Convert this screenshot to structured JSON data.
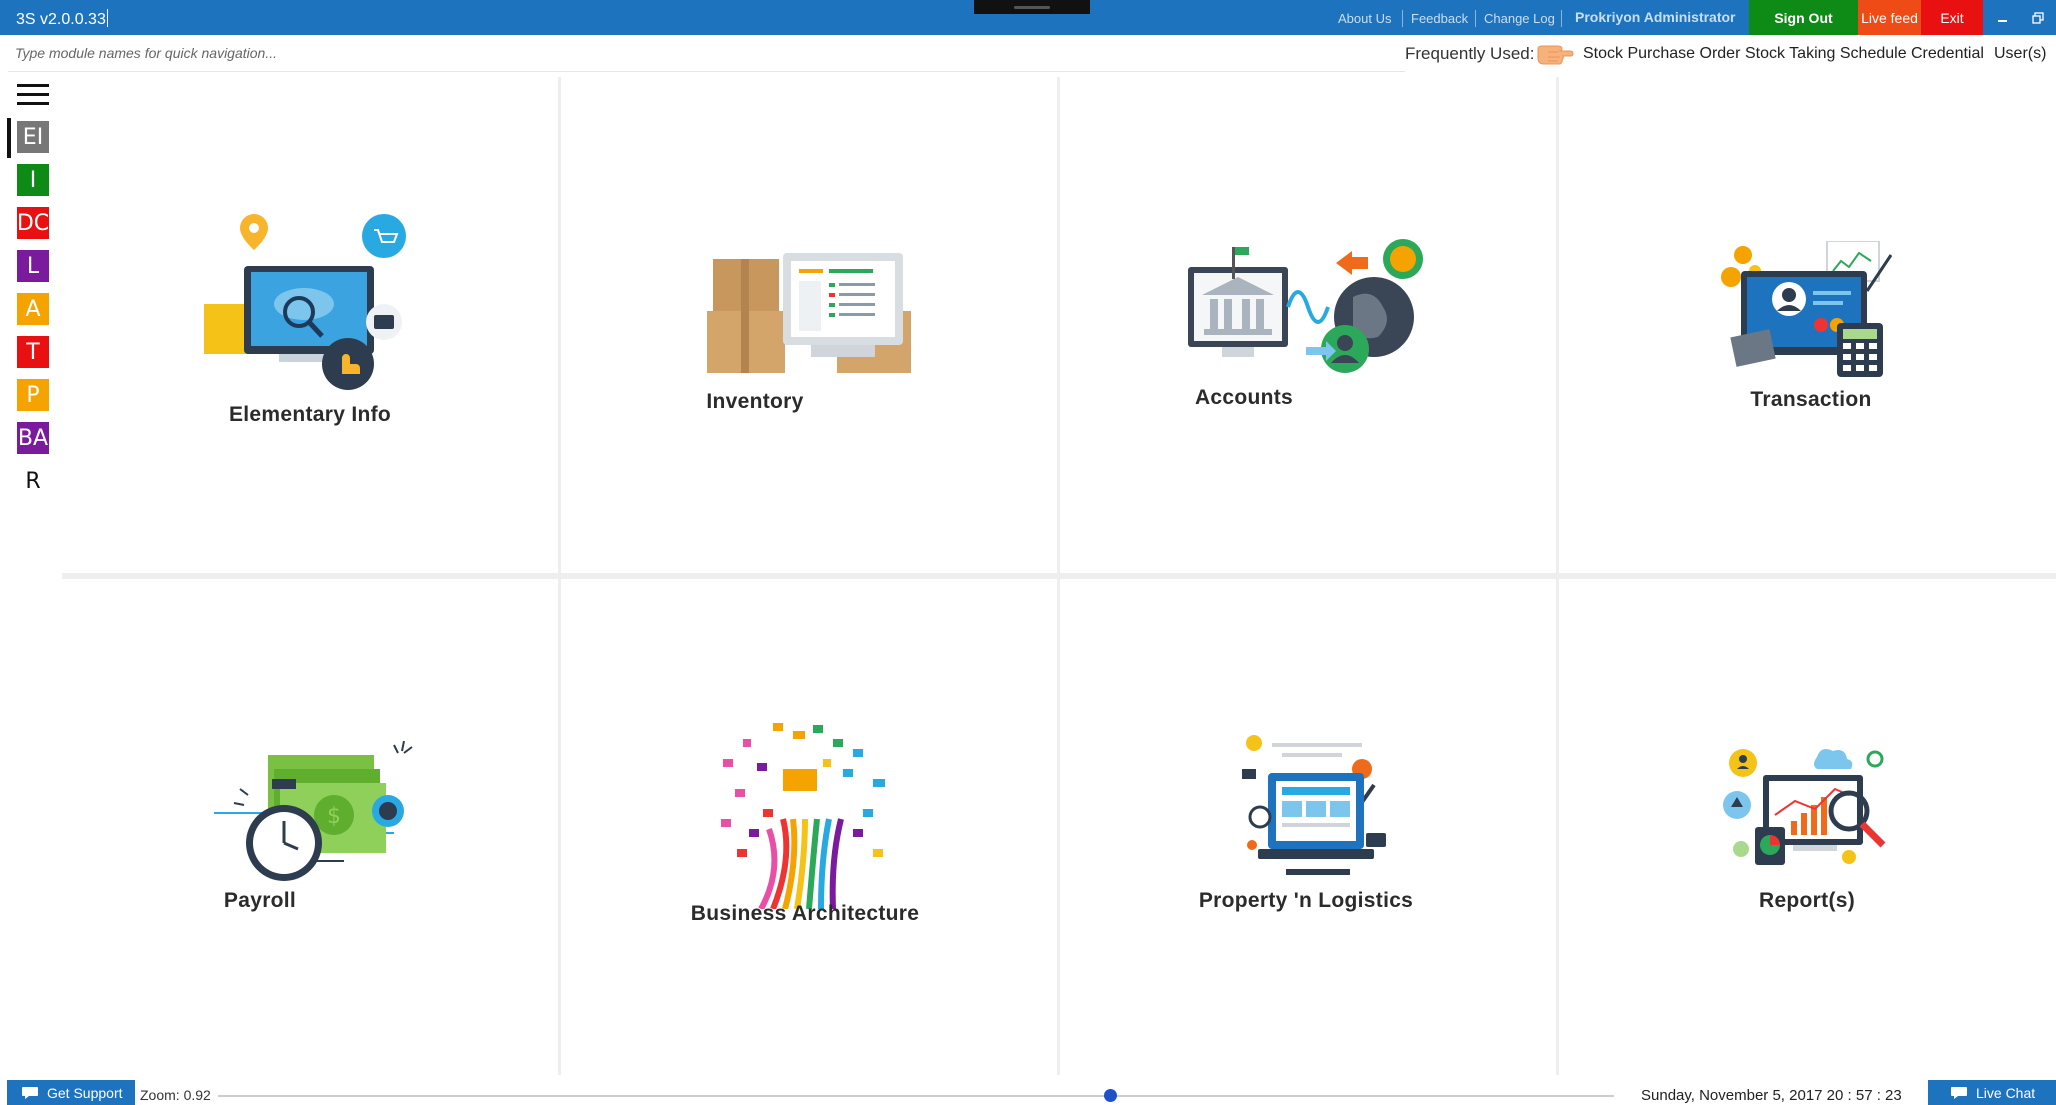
{
  "app": {
    "version": "3S v2.0.0.33"
  },
  "topbar": {
    "links": [
      "About Us",
      "Feedback",
      "Change Log"
    ],
    "user": "Prokriyon Administrator",
    "sign_out": "Sign Out",
    "live_feed": "Live feed",
    "exit": "Exit",
    "colors": {
      "bar": "#1e73be",
      "sign_out": "#0e8a16",
      "live_feed": "#ef4b17",
      "exit": "#e81010"
    }
  },
  "quick_nav": {
    "placeholder": "Type module names for quick navigation..."
  },
  "frequently_used": {
    "label": "Frequently Used:",
    "icon": "pointing-hand-icon",
    "items": [
      "Stock Purchase Order",
      "Stock Taking Schedule",
      "Credential",
      "User(s)"
    ]
  },
  "sidebar": {
    "items": [
      {
        "label": "EI",
        "color": "#777777"
      },
      {
        "label": "I",
        "color": "#0e8a16"
      },
      {
        "label": "DC",
        "color": "#e81010"
      },
      {
        "label": "L",
        "color": "#7a1a9c"
      },
      {
        "label": "A",
        "color": "#f5a300"
      },
      {
        "label": "T",
        "color": "#e81010"
      },
      {
        "label": "P",
        "color": "#f5a300"
      },
      {
        "label": "BA",
        "color": "#7a1a9c"
      },
      {
        "label": "R",
        "color": "#ffffff"
      }
    ]
  },
  "modules": [
    {
      "label": "Elementary Info",
      "icon": "world-map-monitor-icon"
    },
    {
      "label": "Inventory",
      "icon": "boxes-checklist-icon"
    },
    {
      "label": "Accounts",
      "icon": "bank-globe-icon"
    },
    {
      "label": "Transaction",
      "icon": "monitor-calculator-icon"
    },
    {
      "label": "Payroll",
      "icon": "stopwatch-money-icon"
    },
    {
      "label": "Business Architecture",
      "icon": "colorful-tree-icon"
    },
    {
      "label": "Property 'n Logistics",
      "icon": "webpage-laptop-icon"
    },
    {
      "label": "Report(s)",
      "icon": "analytics-magnifier-icon"
    }
  ],
  "footer": {
    "get_support": "Get Support",
    "zoom_label": "Zoom: 0.92",
    "zoom_position": 0.639,
    "datetime": "Sunday, November 5, 2017 20 : 57 : 23",
    "live_chat": "Live Chat"
  }
}
